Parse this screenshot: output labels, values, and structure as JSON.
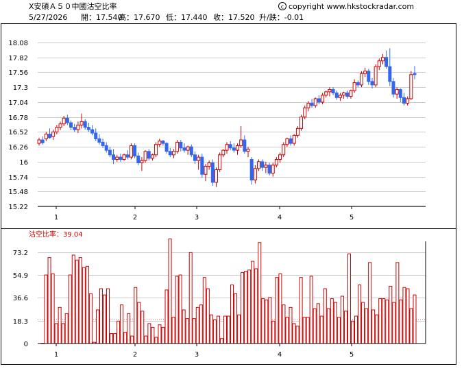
{
  "header": {
    "title": "X安碩Ａ５０中國沽空比率",
    "copyright": "copyright www.hkstockradar.com",
    "copyright_mark": "c",
    "date": "5/27/2026",
    "open_label": "開：",
    "open": "17.540",
    "high_label": "高：",
    "high": "17.670",
    "low_label": "低：",
    "low": "17.440",
    "close_label": "收：",
    "close": "17.520",
    "change_label": "升/跌：",
    "change": "-0.01"
  },
  "colors": {
    "up": "#cc0000",
    "down": "#3366ee",
    "short_ratio": "#cc0000",
    "grid": "#cccccc",
    "frame": "#000000"
  },
  "chart_data": [
    {
      "type": "candlestick",
      "x_tick_labels": [
        "1",
        "2",
        "3",
        "4",
        "5"
      ],
      "y_ticks": [
        15.22,
        15.48,
        15.74,
        16,
        16.26,
        16.52,
        16.78,
        17.04,
        17.3,
        17.56,
        17.82,
        18.08
      ],
      "y_tick_labels": [
        "15.22",
        "15.48",
        "15.74",
        "16",
        "16.26",
        "16.52",
        "16.78",
        "17.04",
        "17.3",
        "17.56",
        "17.82",
        "18.08"
      ],
      "ylim": [
        15.22,
        18.2
      ],
      "grid": true,
      "candles": [
        [
          16.32,
          16.42,
          16.28,
          16.38
        ],
        [
          16.38,
          16.44,
          16.3,
          16.33
        ],
        [
          16.4,
          16.52,
          16.36,
          16.48
        ],
        [
          16.48,
          16.58,
          16.4,
          16.42
        ],
        [
          16.44,
          16.56,
          16.38,
          16.52
        ],
        [
          16.52,
          16.64,
          16.48,
          16.6
        ],
        [
          16.6,
          16.7,
          16.55,
          16.66
        ],
        [
          16.66,
          16.8,
          16.62,
          16.76
        ],
        [
          16.76,
          16.82,
          16.64,
          16.68
        ],
        [
          16.68,
          16.72,
          16.55,
          16.6
        ],
        [
          16.6,
          16.66,
          16.52,
          16.56
        ],
        [
          16.56,
          16.7,
          16.5,
          16.64
        ],
        [
          16.64,
          16.84,
          16.58,
          16.7
        ],
        [
          16.7,
          16.74,
          16.56,
          16.6
        ],
        [
          16.6,
          16.68,
          16.52,
          16.56
        ],
        [
          16.56,
          16.64,
          16.46,
          16.5
        ],
        [
          16.5,
          16.58,
          16.36,
          16.4
        ],
        [
          16.4,
          16.48,
          16.3,
          16.34
        ],
        [
          16.34,
          16.4,
          16.24,
          16.28
        ],
        [
          16.28,
          16.34,
          16.16,
          16.2
        ],
        [
          16.2,
          16.26,
          16.08,
          16.12
        ],
        [
          16.12,
          16.22,
          15.96,
          16.04
        ],
        [
          16.04,
          16.12,
          16,
          16.08
        ],
        [
          16.08,
          16.14,
          16,
          16.04
        ],
        [
          16.04,
          16.14,
          16.02,
          16.12
        ],
        [
          16.12,
          16.2,
          16.04,
          16.08
        ],
        [
          16.08,
          16.32,
          16.04,
          16.28
        ],
        [
          16.28,
          16.32,
          16.06,
          16.1
        ],
        [
          16.1,
          16.16,
          15.94,
          15.98
        ],
        [
          15.98,
          16.08,
          15.84,
          16.02
        ],
        [
          16.02,
          16.2,
          15.98,
          16.18
        ],
        [
          16.18,
          16.22,
          16.02,
          16.06
        ],
        [
          16.06,
          16.14,
          16.02,
          16.12
        ],
        [
          16.12,
          16.34,
          16.08,
          16.3
        ],
        [
          16.3,
          16.4,
          16.26,
          16.36
        ],
        [
          16.36,
          16.38,
          16.28,
          16.32
        ],
        [
          16.32,
          16.34,
          16.14,
          16.18
        ],
        [
          16.18,
          16.24,
          16.08,
          16.12
        ],
        [
          16.12,
          16.22,
          16.06,
          16.18
        ],
        [
          16.18,
          16.38,
          16.14,
          16.34
        ],
        [
          16.34,
          16.38,
          16.18,
          16.24
        ],
        [
          16.24,
          16.32,
          16.16,
          16.2
        ],
        [
          16.2,
          16.28,
          16.12,
          16.26
        ],
        [
          16.26,
          16.3,
          16.08,
          16.12
        ],
        [
          16.12,
          16.18,
          15.96,
          16.02
        ],
        [
          16.02,
          16.12,
          15.86,
          16.08
        ],
        [
          16.08,
          16.14,
          15.72,
          15.78
        ],
        [
          15.78,
          15.96,
          15.66,
          15.92
        ],
        [
          15.92,
          16.02,
          15.86,
          15.98
        ],
        [
          15.98,
          16.04,
          15.58,
          15.64
        ],
        [
          15.64,
          15.9,
          15.56,
          15.86
        ],
        [
          15.86,
          16.16,
          15.82,
          16.12
        ],
        [
          16.12,
          16.22,
          16.08,
          16.2
        ],
        [
          16.2,
          16.34,
          16.14,
          16.3
        ],
        [
          16.3,
          16.36,
          16.2,
          16.24
        ],
        [
          16.24,
          16.32,
          16.16,
          16.2
        ],
        [
          16.2,
          16.32,
          16.12,
          16.28
        ],
        [
          16.28,
          16.62,
          16.24,
          16.38
        ],
        [
          16.38,
          16.46,
          16.14,
          16.18
        ],
        [
          16.18,
          16.26,
          16.08,
          16.22
        ],
        [
          16.04,
          16.08,
          15.6,
          15.68
        ],
        [
          15.68,
          15.94,
          15.62,
          15.88
        ],
        [
          15.88,
          16.04,
          15.84,
          16
        ],
        [
          16,
          16.04,
          15.84,
          15.9
        ],
        [
          15.9,
          16,
          15.8,
          15.94
        ],
        [
          15.94,
          15.98,
          15.76,
          15.8
        ],
        [
          15.8,
          15.98,
          15.74,
          15.94
        ],
        [
          15.94,
          16.08,
          15.9,
          16.04
        ],
        [
          16.04,
          16.16,
          15.98,
          16.12
        ],
        [
          16.12,
          16.34,
          16.08,
          16.3
        ],
        [
          16.3,
          16.42,
          16.26,
          16.4
        ],
        [
          16.4,
          16.46,
          16.28,
          16.32
        ],
        [
          16.32,
          16.48,
          16.28,
          16.46
        ],
        [
          16.46,
          16.62,
          16.42,
          16.58
        ],
        [
          16.58,
          16.82,
          16.54,
          16.78
        ],
        [
          16.78,
          16.98,
          16.74,
          16.94
        ],
        [
          16.94,
          17.06,
          16.88,
          17.02
        ],
        [
          17.02,
          17.1,
          16.94,
          16.98
        ],
        [
          16.98,
          17.12,
          16.94,
          17.1
        ],
        [
          17.1,
          17.16,
          17,
          17.04
        ],
        [
          17.04,
          17.2,
          17,
          17.16
        ],
        [
          17.16,
          17.24,
          17.12,
          17.22
        ],
        [
          17.22,
          17.3,
          17.14,
          17.26
        ],
        [
          17.26,
          17.3,
          17.16,
          17.2
        ],
        [
          17.2,
          17.24,
          17.08,
          17.12
        ],
        [
          17.12,
          17.2,
          17.06,
          17.16
        ],
        [
          17.16,
          17.22,
          17.1,
          17.2
        ],
        [
          17.2,
          17.24,
          17.1,
          17.14
        ],
        [
          17.14,
          17.26,
          17.1,
          17.24
        ],
        [
          17.24,
          17.44,
          17.2,
          17.38
        ],
        [
          17.38,
          17.42,
          17.3,
          17.34
        ],
        [
          17.34,
          17.58,
          17.3,
          17.54
        ],
        [
          17.54,
          17.64,
          17.48,
          17.58
        ],
        [
          17.58,
          17.62,
          17.34,
          17.4
        ],
        [
          17.4,
          17.46,
          17.28,
          17.34
        ],
        [
          17.34,
          17.7,
          17.3,
          17.66
        ],
        [
          17.66,
          17.8,
          17.6,
          17.76
        ],
        [
          17.76,
          17.88,
          17.7,
          17.82
        ],
        [
          17.82,
          17.94,
          17.62,
          17.66
        ],
        [
          17.66,
          17.98,
          17.32,
          17.4
        ],
        [
          17.4,
          17.46,
          17.12,
          17.18
        ],
        [
          17.18,
          17.3,
          17.1,
          17.26
        ],
        [
          17.26,
          17.28,
          17.04,
          17.12
        ],
        [
          17.12,
          17.2,
          16.98,
          17.02
        ],
        [
          17.02,
          17.14,
          16.98,
          17.1
        ],
        [
          17.1,
          17.58,
          17.08,
          17.52
        ],
        [
          17.54,
          17.67,
          17.44,
          17.52
        ]
      ]
    },
    {
      "type": "bar",
      "label": "沽空比率：",
      "label_value": "39.04",
      "x_tick_labels": [
        "1",
        "2",
        "3",
        "4",
        "5"
      ],
      "y_ticks": [
        0,
        18.3,
        36.6,
        54.9,
        73.2
      ],
      "y_tick_labels": [
        "0",
        "18.3",
        "36.6",
        "54.9",
        "73.2"
      ],
      "ylim": [
        0,
        82
      ],
      "grid": true,
      "values": [
        0,
        55,
        69,
        56,
        16,
        29,
        16,
        24,
        55,
        71,
        67,
        69,
        61,
        62,
        40,
        1,
        27,
        44,
        39,
        44,
        8,
        8,
        18,
        31,
        9,
        24,
        6,
        45,
        33,
        26,
        6,
        16,
        13,
        5,
        15,
        13,
        43,
        84,
        21,
        54,
        55,
        27,
        20,
        73,
        20,
        29,
        31,
        53,
        44,
        23,
        19,
        22,
        4,
        22,
        22,
        47,
        40,
        23,
        57,
        58,
        59,
        66,
        60,
        81,
        36,
        35,
        37,
        18,
        53,
        56,
        31,
        21,
        29,
        16,
        14,
        53,
        21,
        21,
        54,
        28,
        32,
        22,
        44,
        28,
        36,
        33,
        21,
        38,
        26,
        72,
        18,
        22,
        47,
        33,
        28,
        65,
        27,
        23,
        36,
        36,
        35,
        46,
        33,
        65,
        35,
        45,
        44,
        28,
        39
      ]
    }
  ]
}
